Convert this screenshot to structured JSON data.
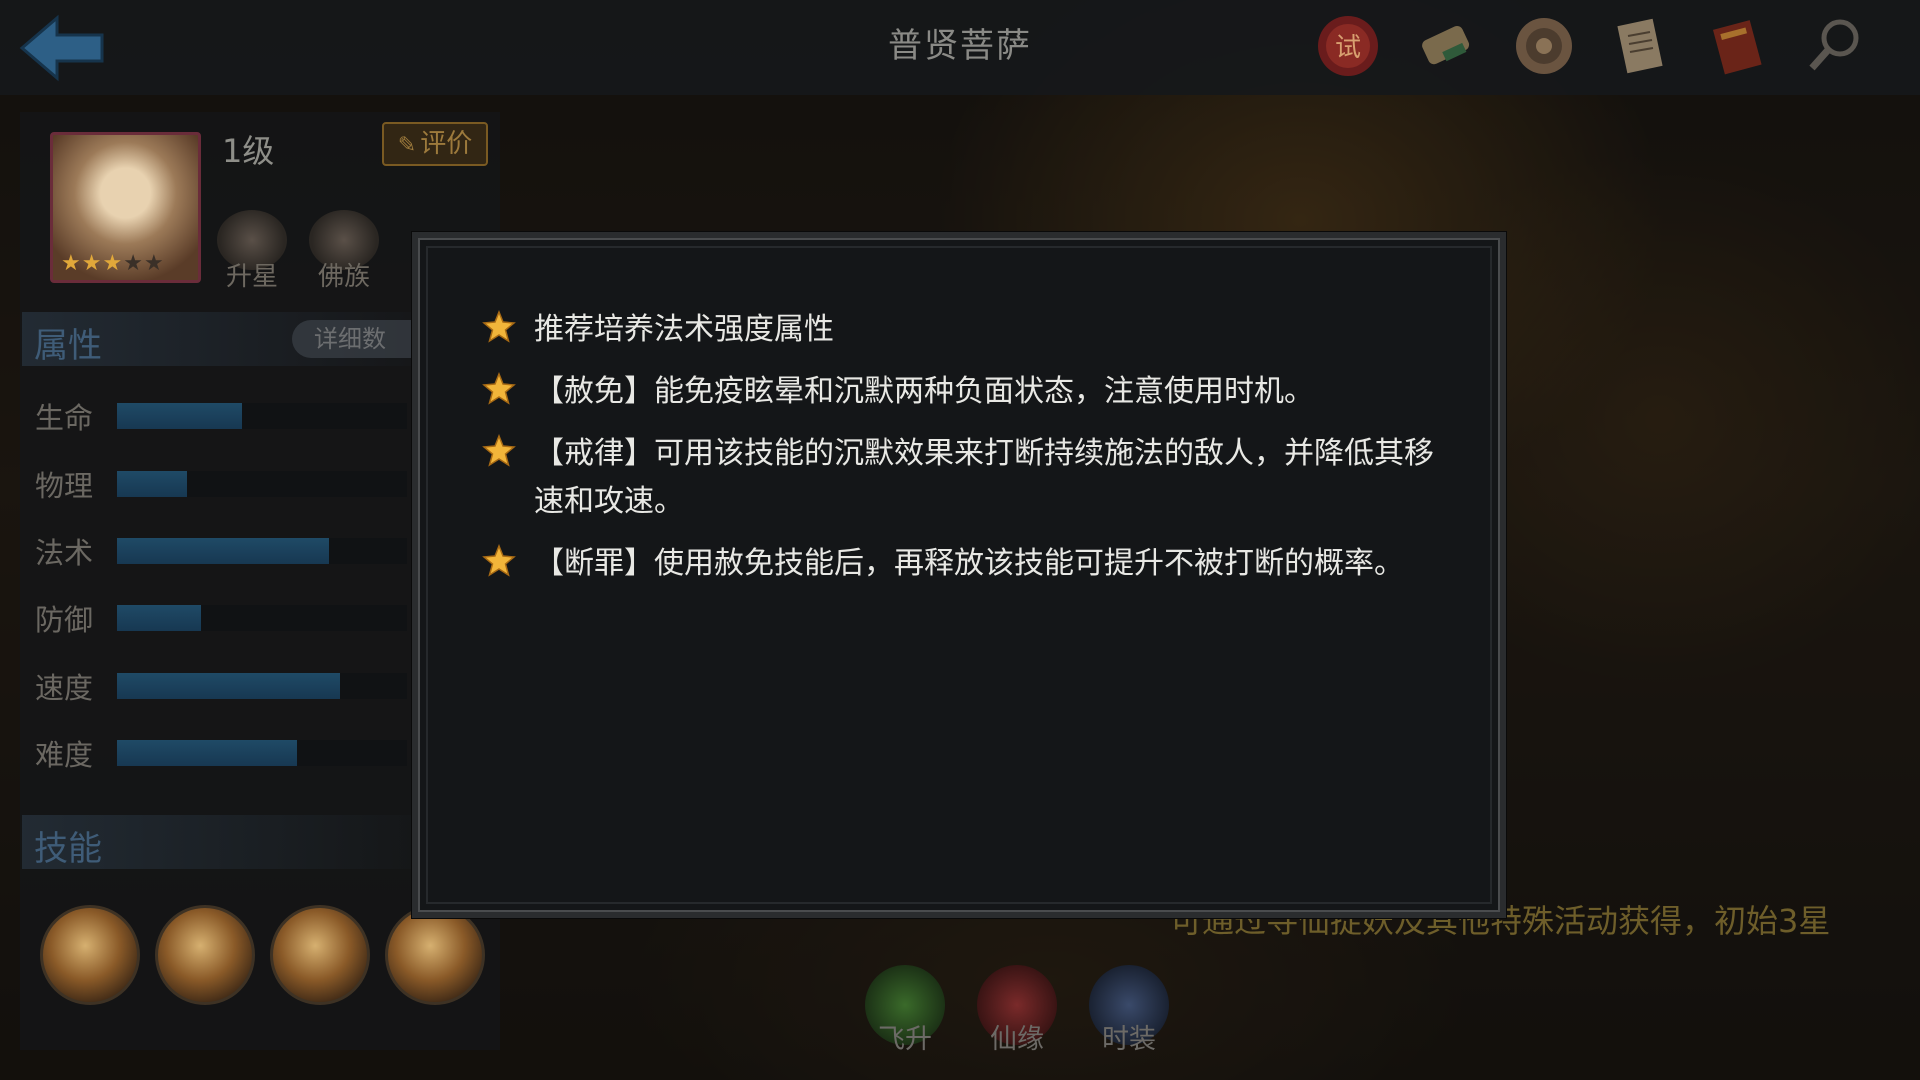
{
  "header": {
    "title": "普贤菩萨",
    "icons": [
      "trial-seal-icon",
      "scroll-icon",
      "medallion-icon",
      "document-icon",
      "book-icon",
      "magnifier-icon"
    ]
  },
  "hero": {
    "level": "1级",
    "rate_label": "评价",
    "stars_filled": 3,
    "stars_total": 5,
    "sub_buttons": [
      "升星",
      "佛族"
    ]
  },
  "attributes": {
    "title": "属性",
    "detail_label": "详细数",
    "stats": [
      {
        "label": "生命",
        "value": 0.43
      },
      {
        "label": "物理",
        "value": 0.24
      },
      {
        "label": "法术",
        "value": 0.73
      },
      {
        "label": "防御",
        "value": 0.29
      },
      {
        "label": "速度",
        "value": 0.77
      },
      {
        "label": "难度",
        "value": 0.62
      }
    ]
  },
  "skills": {
    "title": "技能"
  },
  "bottom": {
    "buttons": [
      "飞升",
      "仙缘",
      "时装"
    ],
    "hint": "可通过寻仙捉妖及其他特殊活动获得，初始3星"
  },
  "modal": {
    "tips": [
      "推荐培养法术强度属性",
      "【赦免】能免疫眩晕和沉默两种负面状态，注意使用时机。",
      "【戒律】可用该技能的沉默效果来打断持续施法的敌人，并降低其移速和攻速。",
      "【断罪】使用赦免技能后，再释放该技能可提升不被打断的概率。"
    ]
  },
  "colors": {
    "star": "#f2b53a",
    "bar": "#1f4a66",
    "accent": "#7a5a22"
  }
}
